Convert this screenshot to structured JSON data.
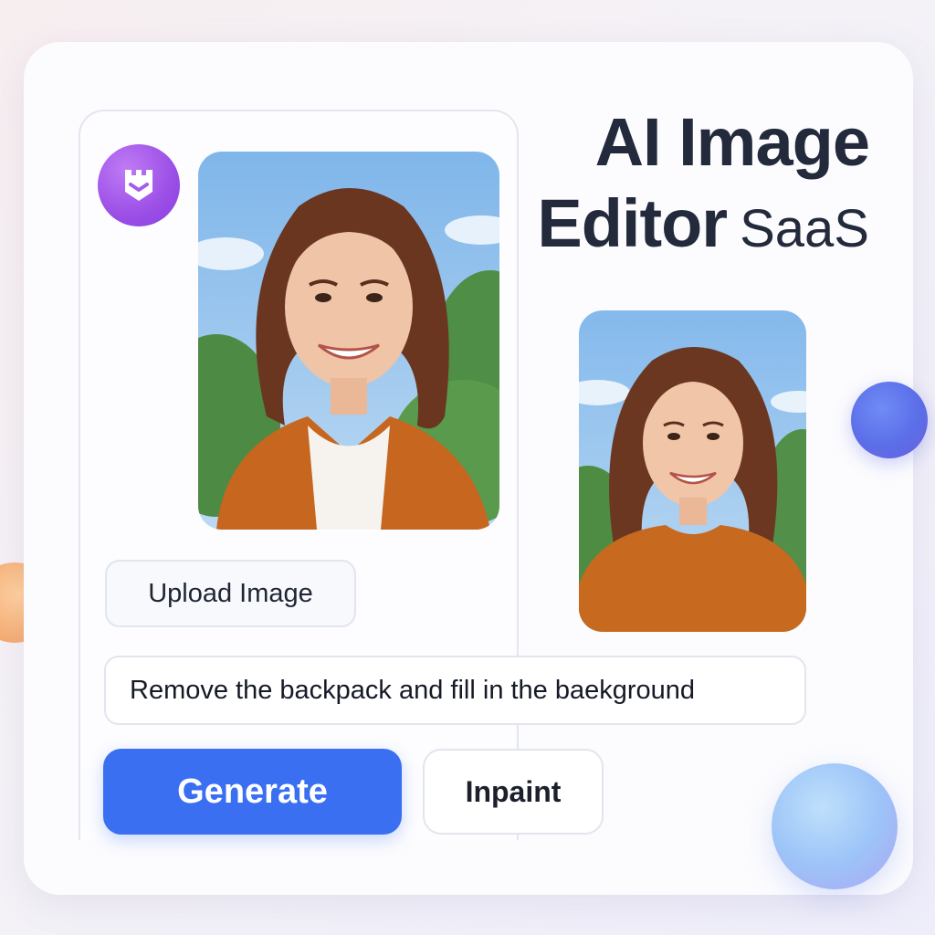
{
  "app": {
    "title_line1": "AI Image",
    "title_line2_bold": "Editor",
    "title_line2_light": "SaaS",
    "logo_icon": "castle-icon",
    "brand_color": "#9b4fe6"
  },
  "images": {
    "original_alt": "portrait-original",
    "result_alt": "portrait-result"
  },
  "controls": {
    "upload_label": "Upload Image",
    "prompt_value": "Remove the backpack and fill in the baekground",
    "generate_label": "Generate",
    "inpaint_label": "Inpaint",
    "accent_color": "#3a6ff2"
  }
}
